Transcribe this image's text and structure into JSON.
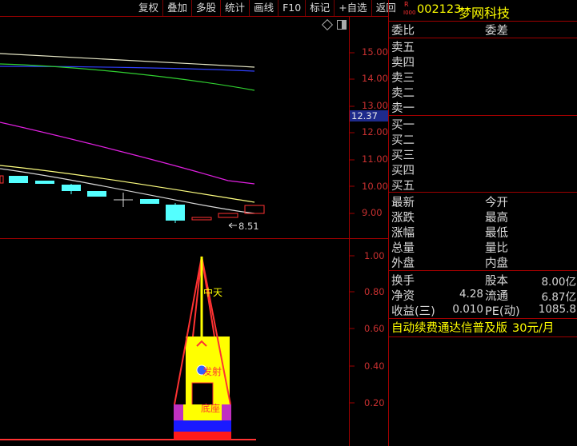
{
  "toolbar": {
    "items": [
      "复权",
      "叠加",
      "多股",
      "统计",
      "画线",
      "F10",
      "标记",
      "+自选",
      "返回"
    ]
  },
  "stock": {
    "badge_top": "R",
    "badge_bottom": "I000",
    "code": "002123",
    "name": "梦网科技"
  },
  "price_axis": {
    "labels": [
      "15.00",
      "14.00",
      "13.00",
      "12.00",
      "11.00",
      "10.00",
      "9.00"
    ],
    "current": "12.37",
    "low_marker": "8.51"
  },
  "indicator_axis": {
    "labels": [
      "1.00",
      "0.80",
      "0.60",
      "0.40",
      "0.20"
    ]
  },
  "indicator_labels": {
    "zhongtian": "中天",
    "fasheng": "发射",
    "dizuo": "底座"
  },
  "orderbook": {
    "ratio_label": "委比",
    "diff_label": "委差",
    "sells": [
      "卖五",
      "卖四",
      "卖三",
      "卖二",
      "卖一"
    ],
    "buys": [
      "买一",
      "买二",
      "买三",
      "买四",
      "买五"
    ]
  },
  "quote": {
    "latest": "最新",
    "open": "今开",
    "change": "涨跌",
    "high": "最高",
    "change_pct": "涨幅",
    "low": "最低",
    "volume": "总量",
    "vol_ratio": "量比",
    "outer": "外盘",
    "inner": "内盘"
  },
  "fundamentals": {
    "turnover_label": "换手",
    "share_capital_label": "股本",
    "share_capital_value": "8.00亿",
    "net_asset_label": "净资",
    "net_asset_value": "4.28",
    "float_label": "流通",
    "float_value": "6.87亿",
    "eps_label": "收益(三)",
    "eps_value": "0.010",
    "pe_label": "PE(动)",
    "pe_value": "1085.8"
  },
  "ad": {
    "text": "自动续费通达信普及版",
    "price": "30元/月"
  },
  "colors": {
    "background": "#000000",
    "border": "#a00000",
    "up": "#ff3232",
    "down": "#54ffff",
    "accent_yellow": "#ffff00",
    "current_price_bg": "#1e2a8c"
  },
  "icons": [
    "diamond-icon",
    "window-toggle-icon"
  ]
}
